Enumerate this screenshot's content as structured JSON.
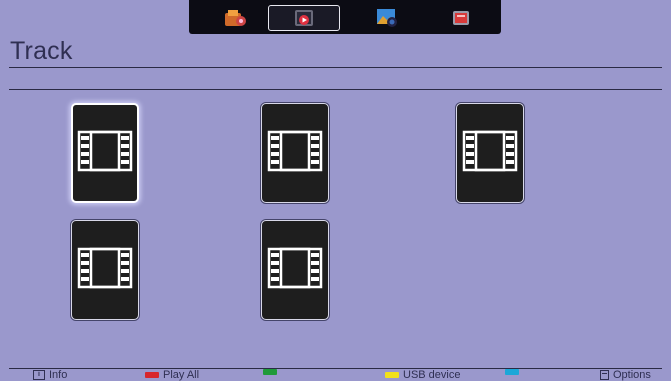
{
  "page": {
    "title": "Track"
  },
  "sources": [
    {
      "icon": "tv-channels-icon",
      "active": false
    },
    {
      "icon": "video-player-icon",
      "active": true
    },
    {
      "icon": "photo-camera-icon",
      "active": false
    },
    {
      "icon": "music-folder-icon",
      "active": false
    }
  ],
  "tracks": [
    {
      "icon": "film-strip-icon",
      "focused": true
    },
    {
      "icon": "film-strip-icon",
      "focused": false
    },
    {
      "icon": "film-strip-icon",
      "focused": false
    },
    {
      "icon": "film-strip-icon",
      "focused": false
    },
    {
      "icon": "film-strip-icon",
      "focused": false
    }
  ],
  "footer": {
    "info_label": "Info",
    "red_label": "Play All",
    "yellow_label": "USB device",
    "options_label": "Options",
    "colors": {
      "red": "#d8262c",
      "green": "#1f9a3a",
      "yellow": "#f2e01a",
      "blue": "#1ca7d8"
    }
  },
  "colors": {
    "background": "#9a98cc",
    "tile": "#1e1e1e"
  }
}
